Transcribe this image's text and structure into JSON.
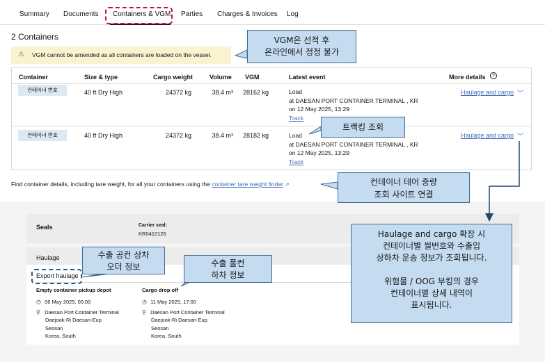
{
  "tabs": [
    "Summary",
    "Documents",
    "Containers & VGM",
    "Parties",
    "Charges & Invoices",
    "Log"
  ],
  "section_title": "2 Containers",
  "warning": {
    "icon": "warning-triangle-icon",
    "text": "VGM cannot be amended as all containers are loaded on the vessel."
  },
  "table": {
    "headers": [
      "Container",
      "Size & type",
      "Cargo weight",
      "Volume",
      "VGM",
      "Latest event",
      "More details"
    ],
    "rows": [
      {
        "container": "컨테이너 번호",
        "size": "40 ft Dry High",
        "weight": "24372 kg",
        "volume": "38.4 m³",
        "vgm": "28162 kg",
        "event": "Load",
        "location": "at DAESAN PORT CONTAINER TERMINAL , KR",
        "date": "on 12 May 2025, 13:29",
        "track": "Track",
        "details": "Haulage and cargo"
      },
      {
        "container": "컨테이너 번호",
        "size": "40 ft Dry High",
        "weight": "24372 kg",
        "volume": "38.4 m³",
        "vgm": "28182 kg",
        "event": "Load",
        "location": "at DAESAN PORT CONTAINER TERMINAL , KR",
        "date": "on 12 May 2025, 13:29",
        "track": "Track",
        "details": "Haulage and cargo"
      }
    ]
  },
  "finder": {
    "prefix": "Find container details, including tare weight, for all your containers using the ",
    "link": "container tare weight finder"
  },
  "seals": {
    "title": "Seals",
    "carrier_label": "Carrier seal:",
    "carrier_value": "KR0410126"
  },
  "haulage": {
    "title": "Haulage",
    "export_title": "Export haulage",
    "pickup": {
      "label": "Empty container pickup depot",
      "date": "06 May 2025, 00:00",
      "address": [
        "Daesan Port Container Terminal",
        "Daejook-Ri Daesan-Eup",
        "Seosan",
        "Korea, South"
      ]
    },
    "dropoff": {
      "label": "Cargo drop off",
      "date": "11 May 2025, 17:00",
      "address": [
        "Daesan Port Container Terminal",
        "Daejook-Ri Daesan-Eup",
        "Seosan",
        "Korea, South"
      ]
    }
  },
  "callouts": {
    "vgm": [
      "VGM은 선적 후",
      "온라인에서 정정 불가"
    ],
    "track": "트랙킹 조회",
    "tare": [
      "컨테이너 테어 중량",
      "조회 사이트 연결"
    ],
    "export_order": [
      "수출 공컨 상차",
      "오더 정보"
    ],
    "export_full": [
      "수출 풀컨",
      "하차 정보"
    ],
    "haulage_info": [
      "Haulage and cargo 확장 시",
      "컨테이너별 씰번호와 수출입",
      "상하차 운송 정보가 조회됩니다.",
      "",
      "위험물 / OOG 부킹의 경우",
      "컨테이너별 상세 내역이",
      "표시됩니다."
    ]
  }
}
